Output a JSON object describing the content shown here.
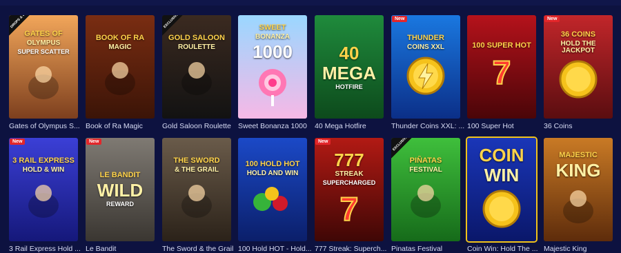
{
  "header": {},
  "games": [
    {
      "caption": "Gates of Olympus S...",
      "corner": "DROPS & WINS",
      "badge": "",
      "lines": [
        "GATES OF",
        "OLYMPUS",
        "SUPER SCATTER"
      ],
      "art": "zeus-figure",
      "colors": [
        "#f2a65a",
        "#7d3f1e"
      ]
    },
    {
      "caption": "Book of Ra Magic",
      "corner": "",
      "badge": "",
      "lines": [
        "BOOK OF RA",
        "MAGIC",
        ""
      ],
      "art": "explorer-figure",
      "colors": [
        "#7a2d12",
        "#3b1407"
      ]
    },
    {
      "caption": "Gold Saloon Roulette",
      "corner": "EXCLUSIVE",
      "badge": "",
      "lines": [
        "GOLD SALOON",
        "ROULETTE",
        ""
      ],
      "art": "dealer-figure",
      "colors": [
        "#3b2a20",
        "#121212"
      ]
    },
    {
      "caption": "Sweet Bonanza 1000",
      "corner": "",
      "badge": "",
      "lines": [
        "SWEET",
        "BONANZA",
        "1000"
      ],
      "art": "lollipop",
      "colors": [
        "#9ad7ff",
        "#f6b8e6"
      ]
    },
    {
      "caption": "40 Mega Hotfire",
      "corner": "",
      "badge": "",
      "lines": [
        "40",
        "MEGA",
        "HOTFIRE"
      ],
      "art": "",
      "colors": [
        "#1f8b3c",
        "#0d4a1c"
      ]
    },
    {
      "caption": "Thunder Coins XXL: ...",
      "corner": "",
      "badge": "New",
      "lines": [
        "THUNDER",
        "COINS XXL",
        ""
      ],
      "art": "lightning-coin",
      "colors": [
        "#1a78e0",
        "#0b2f88"
      ]
    },
    {
      "caption": "100 Super Hot",
      "corner": "",
      "badge": "",
      "lines": [
        "100 SUPER HOT",
        "",
        ""
      ],
      "art": "seven",
      "colors": [
        "#b5121b",
        "#4a0508"
      ]
    },
    {
      "caption": "36 Coins",
      "corner": "",
      "badge": "New",
      "lines": [
        "36 COINS",
        "HOLD THE JACKPOT",
        ""
      ],
      "art": "big-coin",
      "colors": [
        "#c2262a",
        "#5a0d10"
      ]
    },
    {
      "caption": "3 Rail Express Hold ...",
      "corner": "",
      "badge": "New",
      "lines": [
        "3 RAIL EXPRESS",
        "HOLD & WIN",
        ""
      ],
      "art": "train",
      "colors": [
        "#3b3fd6",
        "#15187a"
      ]
    },
    {
      "caption": "Le Bandit",
      "corner": "",
      "badge": "New",
      "lines": [
        "LE BANDIT",
        "WILD",
        "REWARD"
      ],
      "art": "",
      "colors": [
        "#7f7a73",
        "#3a3631"
      ]
    },
    {
      "caption": "The Sword & the Grail",
      "corner": "",
      "badge": "",
      "lines": [
        "THE SWORD",
        "& THE GRAIL",
        ""
      ],
      "art": "knight",
      "colors": [
        "#6a5b4a",
        "#2b2219"
      ]
    },
    {
      "caption": "100 Hold HOT - Hold...",
      "corner": "",
      "badge": "",
      "lines": [
        "100 HOLD HOT",
        "HOLD AND WIN",
        ""
      ],
      "art": "fruits",
      "colors": [
        "#1b49c7",
        "#0b1f6a"
      ]
    },
    {
      "caption": "777 Streak: Superch...",
      "corner": "",
      "badge": "New",
      "lines": [
        "777",
        "STREAK",
        "SUPERCHARGED"
      ],
      "art": "seven",
      "colors": [
        "#b21a14",
        "#3f0705"
      ]
    },
    {
      "caption": "Pinatas Festival",
      "corner": "EXCLUSIVE",
      "badge": "",
      "lines": [
        "PIÑATAS",
        "FESTIVAL",
        ""
      ],
      "art": "pinata",
      "colors": [
        "#3fbf3c",
        "#166b1a"
      ]
    },
    {
      "caption": "Coin Win: Hold The ...",
      "corner": "",
      "badge": "",
      "lines": [
        "COIN",
        "WIN",
        ""
      ],
      "art": "big-coin",
      "colors": [
        "#1a36b8",
        "#0a176a"
      ]
    },
    {
      "caption": "Majestic King",
      "corner": "",
      "badge": "",
      "lines": [
        "MAJESTIC",
        "KING",
        ""
      ],
      "art": "lion",
      "colors": [
        "#c97a25",
        "#5e2c0b"
      ]
    }
  ],
  "selected_index": 14
}
